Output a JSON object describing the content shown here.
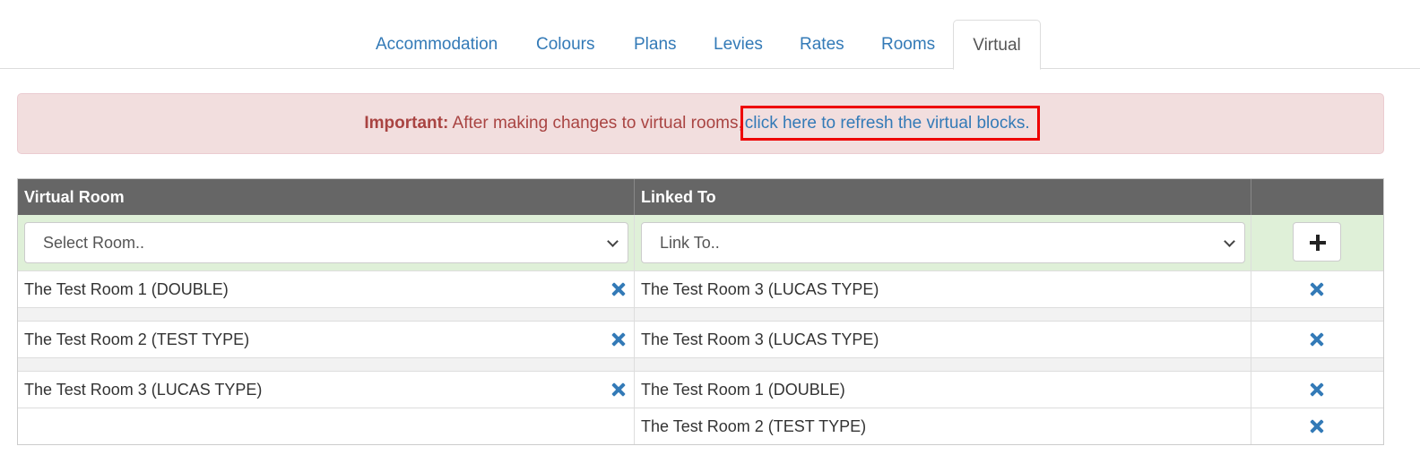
{
  "tabs": [
    {
      "label": "Accommodation",
      "active": false
    },
    {
      "label": "Colours",
      "active": false
    },
    {
      "label": "Plans",
      "active": false
    },
    {
      "label": "Levies",
      "active": false
    },
    {
      "label": "Rates",
      "active": false
    },
    {
      "label": "Rooms",
      "active": false
    },
    {
      "label": "Virtual",
      "active": true
    }
  ],
  "alert": {
    "strong": "Important:",
    "text": " After making changes to virtual rooms,",
    "link": "click here to refresh the virtual blocks."
  },
  "table": {
    "headers": [
      "Virtual Room",
      "Linked To",
      ""
    ],
    "new_row": {
      "room_select": "Select Room..",
      "link_select": "Link To.."
    },
    "groups": [
      {
        "room": "The Test Room 1 (DOUBLE)",
        "links": [
          "The Test Room 3 (LUCAS TYPE)"
        ]
      },
      {
        "room": "The Test Room 2 (TEST TYPE)",
        "links": [
          "The Test Room 3 (LUCAS TYPE)"
        ]
      },
      {
        "room": "The Test Room 3 (LUCAS TYPE)",
        "links": [
          "The Test Room 1 (DOUBLE)",
          "The Test Room 2 (TEST TYPE)"
        ]
      }
    ]
  },
  "colors": {
    "link": "#337ab7",
    "alert_bg": "#f2dede",
    "alert_text": "#a94442",
    "header_bg": "#666666",
    "new_row_bg": "#dff0d8",
    "highlight": "#ee0000"
  },
  "icons": {
    "remove": "close-icon",
    "add": "plus-icon",
    "dropdown": "chevron-down-icon"
  }
}
